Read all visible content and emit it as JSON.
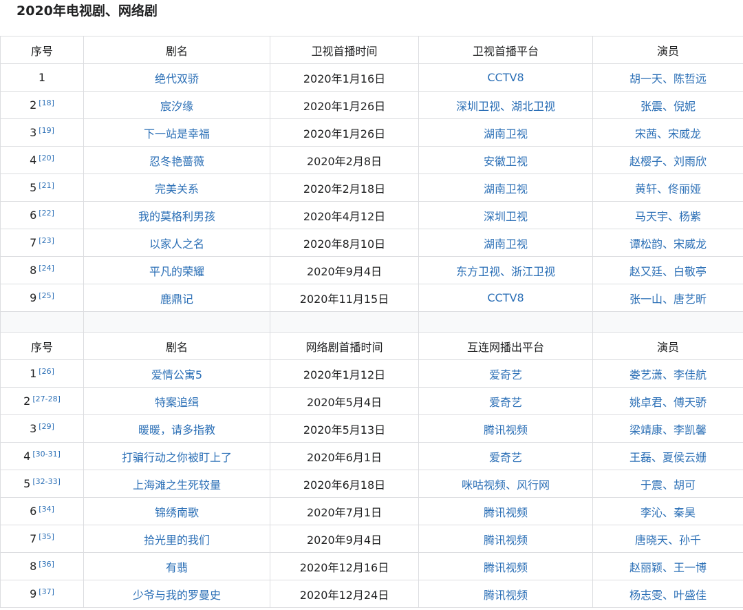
{
  "heading": "2020年电视剧、网络剧",
  "tv_table": {
    "headers": [
      "序号",
      "剧名",
      "卫视首播时间",
      "卫视首播平台",
      "演员"
    ],
    "rows": [
      {
        "num": "1",
        "ref": "",
        "title": "绝代双骄",
        "date": "2020年1月16日",
        "platform": "CCTV8",
        "actors": "胡一天、陈哲远"
      },
      {
        "num": "2",
        "ref": "[18]",
        "title": "宸汐缘",
        "date": "2020年1月26日",
        "platform": "深圳卫视、湖北卫视",
        "actors": "张震、倪妮"
      },
      {
        "num": "3",
        "ref": "[19]",
        "title": "下一站是幸福",
        "date": "2020年1月26日",
        "platform": "湖南卫视",
        "actors": "宋茜、宋威龙"
      },
      {
        "num": "4",
        "ref": "[20]",
        "title": "忍冬艳蔷薇",
        "date": "2020年2月8日",
        "platform": "安徽卫视",
        "actors": "赵樱子、刘雨欣"
      },
      {
        "num": "5",
        "ref": "[21]",
        "title": "完美关系",
        "date": "2020年2月18日",
        "platform": "湖南卫视",
        "actors": "黄轩、佟丽娅"
      },
      {
        "num": "6",
        "ref": "[22]",
        "title": "我的莫格利男孩",
        "date": "2020年4月12日",
        "platform": "深圳卫视",
        "actors": "马天宇、杨紫"
      },
      {
        "num": "7",
        "ref": "[23]",
        "title": "以家人之名",
        "date": "2020年8月10日",
        "platform": "湖南卫视",
        "actors": "谭松韵、宋威龙"
      },
      {
        "num": "8",
        "ref": "[24]",
        "title": "平凡的荣耀",
        "date": "2020年9月4日",
        "platform": "东方卫视、浙江卫视",
        "actors": "赵又廷、白敬亭"
      },
      {
        "num": "9",
        "ref": "[25]",
        "title": "鹿鼎记",
        "date": "2020年11月15日",
        "platform": "CCTV8",
        "actors": "张一山、唐艺昕"
      }
    ]
  },
  "web_table": {
    "headers": [
      "序号",
      "剧名",
      "网络剧首播时间",
      "互连网播出平台",
      "演员"
    ],
    "rows": [
      {
        "num": "1",
        "ref": "[26]",
        "title": "爱情公寓5",
        "date": "2020年1月12日",
        "platform": "爱奇艺",
        "actors": "娄艺潇、李佳航"
      },
      {
        "num": "2",
        "ref": "[27-28]",
        "title": "特案追缉",
        "date": "2020年5月4日",
        "platform": "爱奇艺",
        "actors": "姚卓君、傅天骄"
      },
      {
        "num": "3",
        "ref": "[29]",
        "title": "暖暖，请多指教",
        "date": "2020年5月13日",
        "platform": "腾讯视频",
        "actors": "梁靖康、李凯馨"
      },
      {
        "num": "4",
        "ref": "[30-31]",
        "title": "打骗行动之你被盯上了",
        "date": "2020年6月1日",
        "platform": "爱奇艺",
        "actors": "王磊、夏侯云姗"
      },
      {
        "num": "5",
        "ref": "[32-33]",
        "title": "上海滩之生死较量",
        "date": "2020年6月18日",
        "platform": "咪咕视频、风行网",
        "actors": "于震、胡可"
      },
      {
        "num": "6",
        "ref": "[34]",
        "title": "锦绣南歌",
        "date": "2020年7月1日",
        "platform": "腾讯视频",
        "actors": "李沁、秦昊"
      },
      {
        "num": "7",
        "ref": "[35]",
        "title": "拾光里的我们",
        "date": "2020年9月4日",
        "platform": "腾讯视频",
        "actors": "唐晓天、孙千"
      },
      {
        "num": "8",
        "ref": "[36]",
        "title": "有翡",
        "date": "2020年12月16日",
        "platform": "腾讯视频",
        "actors": "赵丽颖、王一博"
      },
      {
        "num": "9",
        "ref": "[37]",
        "title": "少爷与我的罗曼史",
        "date": "2020年12月24日",
        "platform": "腾讯视频",
        "actors": "杨志雯、叶盛佳"
      }
    ]
  },
  "colors": {
    "link": "#2b6fb6",
    "text": "#202122",
    "border": "#dcdde0"
  }
}
